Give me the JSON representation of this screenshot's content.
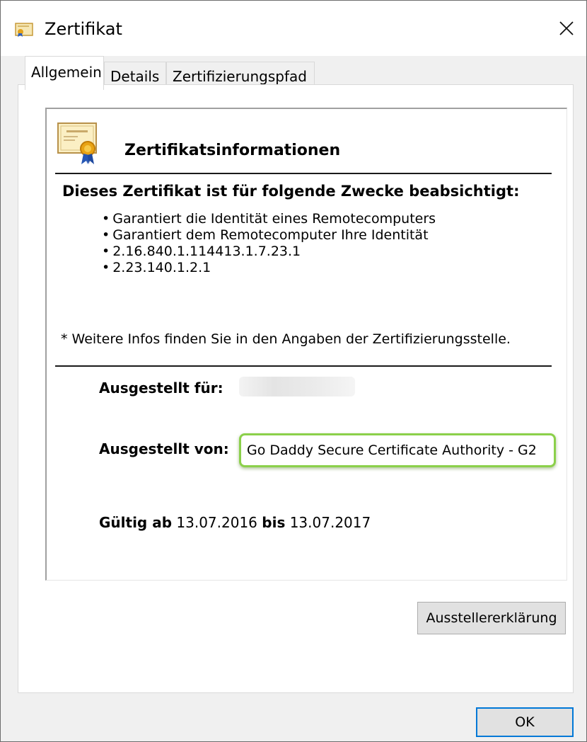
{
  "window": {
    "title": "Zertifikat",
    "icon": "certificate-icon",
    "close_icon": "close-icon"
  },
  "tabs": [
    {
      "label": "Allgemein",
      "active": true
    },
    {
      "label": "Details",
      "active": false
    },
    {
      "label": "Zertifizierungspfad",
      "active": false
    }
  ],
  "info": {
    "heading": "Zertifikatsinformationen",
    "purpose_heading": "Dieses Zertifikat ist für folgende Zwecke beabsichtigt:",
    "purposes": [
      "Garantiert die Identität eines Remotecomputers",
      "Garantiert dem Remotecomputer Ihre Identität",
      "2.16.840.1.114413.1.7.23.1",
      "2.23.140.1.2.1"
    ],
    "note": "* Weitere Infos finden Sie in den Angaben der Zertifizierungsstelle.",
    "issued_to_label": "Ausgestellt für:",
    "issued_by_label": "Ausgestellt von:",
    "issued_by_value": "Go Daddy Secure Certificate Authority - G2",
    "valid_from_label": "Gültig ab",
    "valid_from": "13.07.2016",
    "valid_to_label": "bis",
    "valid_to": "13.07.2017"
  },
  "buttons": {
    "issuer_statement": "Ausstellererklärung",
    "ok": "OK"
  },
  "colors": {
    "highlight": "#8bd04a",
    "focus": "#0078d7"
  }
}
